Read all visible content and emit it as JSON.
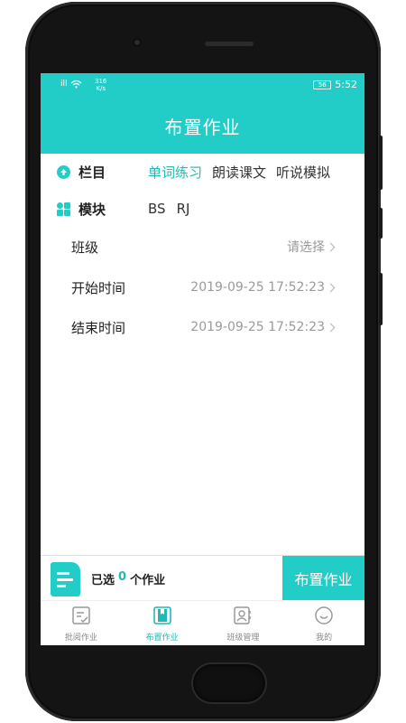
{
  "status_bar": {
    "signal": "ill",
    "speed_value": "316",
    "speed_unit": "K/s",
    "battery": "56",
    "time": "5:52"
  },
  "header": {
    "title": "布置作业"
  },
  "column_row": {
    "label": "栏目",
    "tabs": [
      {
        "label": "单词练习",
        "active": true
      },
      {
        "label": "朗读课文",
        "active": false
      },
      {
        "label": "听说模拟",
        "active": false
      }
    ]
  },
  "module_row": {
    "label": "模块",
    "items": [
      "BS",
      "RJ"
    ]
  },
  "form": {
    "class": {
      "label": "班级",
      "value": "请选择"
    },
    "start_time": {
      "label": "开始时间",
      "value": "2019-09-25 17:52:23"
    },
    "end_time": {
      "label": "结束时间",
      "value": "2019-09-25 17:52:23"
    }
  },
  "bottom_bar": {
    "selected_prefix": "已选",
    "selected_count": "0",
    "selected_suffix": "个作业",
    "assign_button": "布置作业"
  },
  "tabbar": {
    "items": [
      {
        "label": "批阅作业",
        "icon": "review-icon",
        "active": false
      },
      {
        "label": "布置作业",
        "icon": "assign-icon",
        "active": true
      },
      {
        "label": "班级管理",
        "icon": "class-icon",
        "active": false
      },
      {
        "label": "我的",
        "icon": "smile-icon",
        "active": false
      }
    ]
  },
  "colors": {
    "accent": "#22cdc7",
    "accent_text": "#22b8b3",
    "frame": "#141414"
  }
}
